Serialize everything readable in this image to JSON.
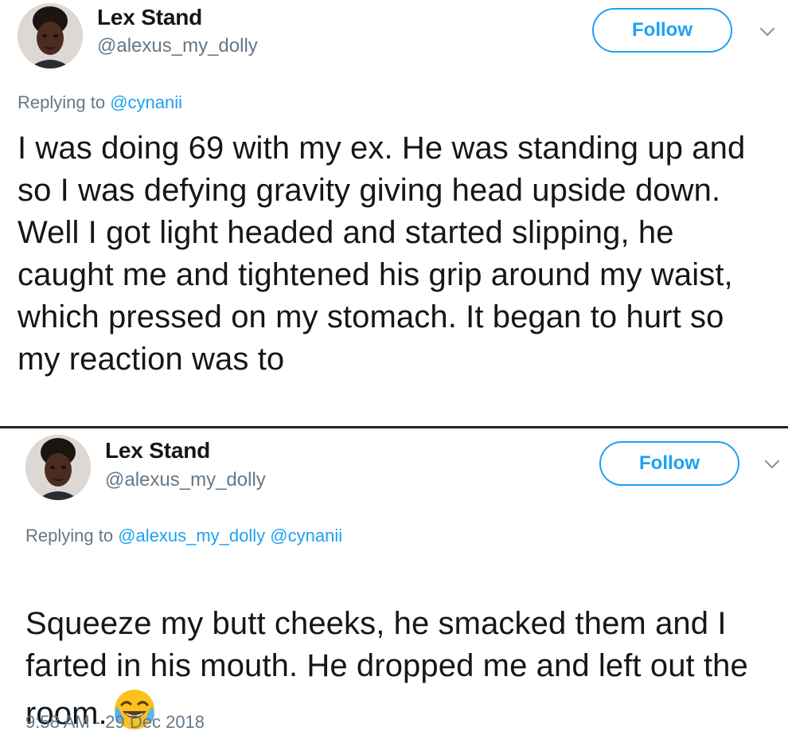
{
  "tweets": [
    {
      "author": {
        "name": "Lex Stand",
        "handle": "@alexus_my_dolly"
      },
      "follow_label": "Follow",
      "caret_icon": "chevron-down-icon",
      "reply": {
        "prefix": "Replying to ",
        "mentions": [
          "@cynanii"
        ]
      },
      "text": "I was doing 69 with my ex. He was standing up and so I was defying gravity giving head upside down. Well I got light headed and started slipping, he caught me and tightened his grip around my waist, which pressed on my stomach. It began to hurt so my reaction was to"
    },
    {
      "author": {
        "name": "Lex Stand",
        "handle": "@alexus_my_dolly"
      },
      "follow_label": "Follow",
      "caret_icon": "chevron-down-icon",
      "reply": {
        "prefix": "Replying to ",
        "mentions": [
          "@alexus_my_dolly",
          "@cynanii"
        ]
      },
      "text": "Squeeze my butt cheeks, he smacked them and I farted in his mouth. He dropped me and left out the room.",
      "emoji": "face-with-tears-of-joy-icon",
      "timestamp": "9:58 AM - 29 Dec 2018"
    }
  ],
  "colors": {
    "accent": "#1da1f2",
    "secondary_text": "#657786",
    "primary_text": "#14171a"
  }
}
